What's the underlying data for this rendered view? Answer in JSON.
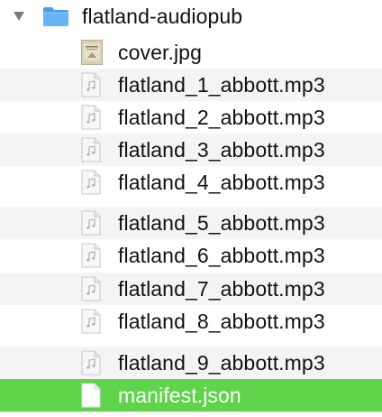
{
  "folder": {
    "name": "flatland-audiopub",
    "icon": "folder-icon",
    "expanded": true
  },
  "files": [
    {
      "name": "cover.jpg",
      "icon": "image-thumbnail-icon"
    },
    {
      "name": "flatland_1_abbott.mp3",
      "icon": "audio-file-icon"
    },
    {
      "name": "flatland_2_abbott.mp3",
      "icon": "audio-file-icon"
    },
    {
      "name": "flatland_3_abbott.mp3",
      "icon": "audio-file-icon"
    },
    {
      "name": "flatland_4_abbott.mp3",
      "icon": "audio-file-icon"
    },
    {
      "name": "flatland_5_abbott.mp3",
      "icon": "audio-file-icon"
    },
    {
      "name": "flatland_6_abbott.mp3",
      "icon": "audio-file-icon"
    },
    {
      "name": "flatland_7_abbott.mp3",
      "icon": "audio-file-icon"
    },
    {
      "name": "flatland_8_abbott.mp3",
      "icon": "audio-file-icon"
    },
    {
      "name": "flatland_9_abbott.mp3",
      "icon": "audio-file-icon"
    },
    {
      "name": "manifest.json",
      "icon": "document-file-icon",
      "selected": true
    }
  ],
  "colors": {
    "selection": "#5fd34a",
    "folder": "#5aaaf0",
    "alternate_row": "#f4f4f4"
  }
}
